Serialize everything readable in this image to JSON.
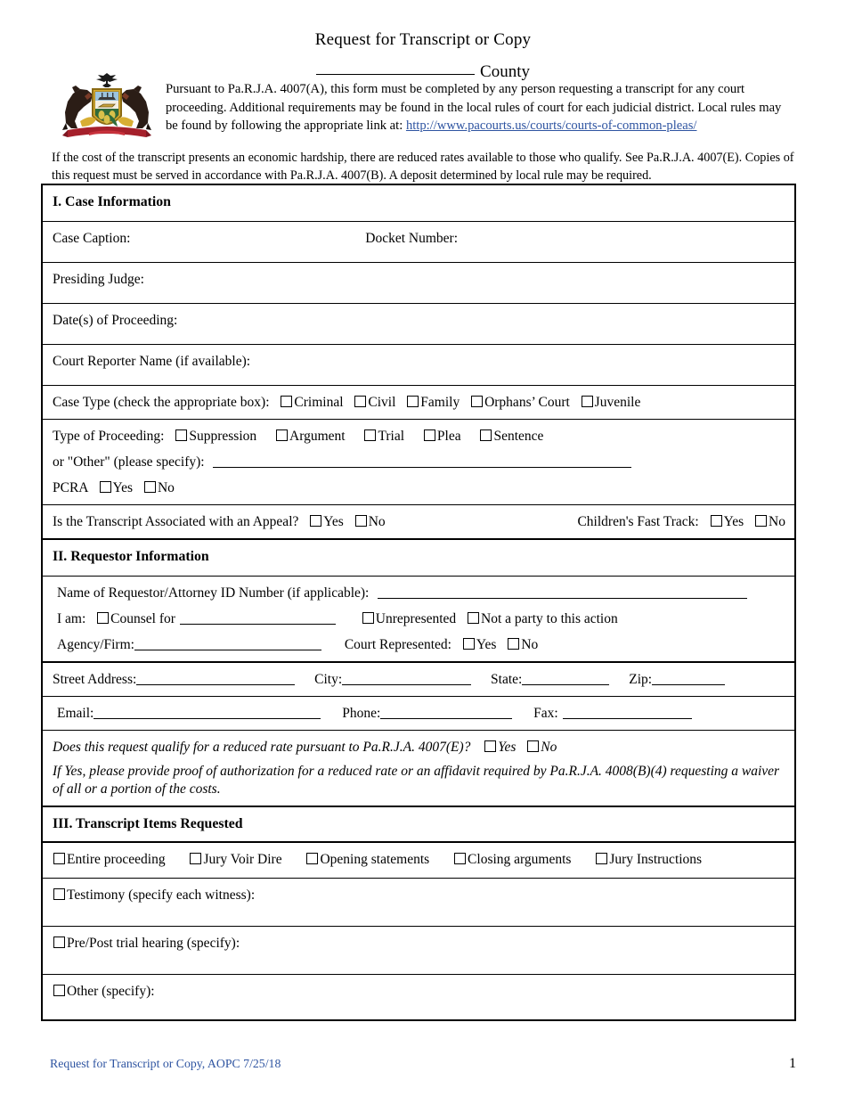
{
  "document": {
    "title": "Request for Transcript or Copy",
    "county_label": "County",
    "county_blank_value": "",
    "intro_paragraph": "Pursuant to Pa.R.J.A. 4007(A), this form must be completed by any person requesting a transcript for any court proceeding. Additional requirements may be found in the local rules of court for each judicial district. Local rules may be found by following the appropriate link at:",
    "intro_link_text": "http://www.pacourts.us/courts/courts-of-common-pleas/",
    "hardship_paragraph": "If the cost of the transcript presents an economic hardship, there are reduced rates available to those who qualify. See Pa.R.J.A. 4007(E). Copies of this request must be served in accordance with Pa.R.J.A. 4007(B). A deposit determined by local rule may be required.",
    "seal_alt": "pennsylvania-coat-of-arms"
  },
  "colors": {
    "link": "#2e54a1",
    "footer": "#2e54a1",
    "border": "#000000",
    "page_background": "#ffffff"
  },
  "section_one": {
    "heading": "I. Case Information",
    "case_caption_label": "Case Caption:",
    "docket_number_label": "Docket Number:",
    "presiding_judge_label": "Presiding Judge:",
    "dates_of_proceeding_label": "Date(s) of Proceeding:",
    "court_reporter_label": "Court Reporter Name (if available):",
    "case_type_label": "Case Type (check the appropriate box):",
    "case_type_options": [
      "Criminal",
      "Civil",
      "Family",
      "Orphans’ Court",
      "Juvenile"
    ],
    "type_of_proceeding_label": "Type of Proceeding:",
    "type_of_proceeding_options": [
      "Suppression",
      "Argument",
      "Trial",
      "Plea",
      "Sentence"
    ],
    "other_specify_label": "or \"Other\" (please specify):",
    "other_specify_value": "",
    "pcra_label": "PCRA",
    "pcra_yes": "Yes",
    "pcra_no": "No",
    "appeal_question": "Is the Transcript Associated with an Appeal?",
    "appeal_yes": "Yes",
    "appeal_no": "No",
    "fast_track_label": "Children's Fast Track:",
    "fast_track_yes": "Yes",
    "fast_track_no": "No"
  },
  "section_two": {
    "heading": "II. Requestor Information",
    "name_label": "Name of Requestor/Attorney ID Number (if applicable):",
    "name_value": "",
    "i_am_label": "I am:",
    "counsel_for_label": "Counsel for",
    "counsel_for_value": "",
    "unrepresented_label": "Unrepresented",
    "not_a_party_label": "Not a party to this action",
    "agency_firm_label": "Agency/Firm:",
    "agency_firm_value": "",
    "court_represented_label": "Court Represented:",
    "court_represented_yes": "Yes",
    "court_represented_no": "No",
    "street_address_label": "Street Address:",
    "street_address_value": "",
    "city_label": "City:",
    "city_value": "",
    "state_label": "State:",
    "state_value": "",
    "zip_label": "Zip:",
    "zip_value": "",
    "email_label": "Email:",
    "email_value": "",
    "phone_label": "Phone:",
    "phone_value": "",
    "fax_label": "Fax:",
    "fax_value": "",
    "reduced_rate_question": "Does this request qualify for a reduced rate pursuant to Pa.R.J.A. 4007(E)?",
    "reduced_rate_yes": "Yes",
    "reduced_rate_no": "No",
    "reduced_rate_note": "If Yes, please provide proof of authorization for a reduced rate or an affidavit required by Pa.R.J.A. 4008(B)(4) requesting a waiver of all or a portion of the costs."
  },
  "section_three": {
    "heading": "III. Transcript Items Requested",
    "items_row": [
      "Entire proceeding",
      "Jury Voir Dire",
      "Opening statements",
      "Closing arguments",
      "Jury Instructions"
    ],
    "testimony_label": "Testimony (specify each witness):",
    "testimony_value": "",
    "pre_post_label": "Pre/Post trial hearing (specify):",
    "pre_post_value": "",
    "other_label": "Other (specify):",
    "other_value": ""
  },
  "footer": {
    "left_text": "Request for Transcript or Copy, AOPC 7/25/18",
    "page_number": "1"
  }
}
